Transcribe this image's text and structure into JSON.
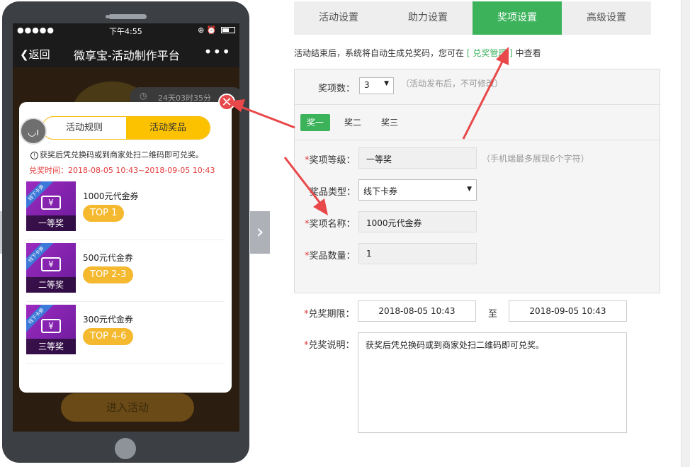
{
  "phone": {
    "status": {
      "signal": "●●●●●",
      "time": "下午4:55"
    },
    "nav": {
      "back": "返回",
      "title": "微享宝-活动制作平台",
      "more": "•••"
    },
    "timer": "24天03时35分",
    "join_button": "进入活动",
    "modal": {
      "close": "✕",
      "tabs": [
        {
          "label": "活动规则"
        },
        {
          "label": "活动奖品"
        }
      ],
      "notice": "获奖后凭兑换码或到商家处扫二维码即可兑奖。",
      "redeem_time": "兑奖时间：2018-08-05 10:43~2018-09-05 10:43",
      "prizes": [
        {
          "ribbon": "线下卡券",
          "grade": "一等奖",
          "name": "1000元代金券",
          "rank": "TOP 1"
        },
        {
          "ribbon": "线下卡券",
          "grade": "二等奖",
          "name": "500元代金券",
          "rank": "TOP 2-3"
        },
        {
          "ribbon": "线下卡券",
          "grade": "三等奖",
          "name": "300元代金券",
          "rank": "TOP 4-6"
        }
      ]
    }
  },
  "top_tabs": [
    {
      "label": "活动设置"
    },
    {
      "label": "助力设置"
    },
    {
      "label": "奖项设置"
    },
    {
      "label": "高级设置"
    }
  ],
  "hint": {
    "before": "活动结束后，系统将自动生成兑奖码，您可在 ",
    "link": "[ 兑奖管理 ]",
    "after": " 中查看"
  },
  "form": {
    "count_label": "奖项数：",
    "count_value": "3",
    "count_note": "（活动发布后，不可修改）",
    "prize_tabs": [
      {
        "label": "奖一"
      },
      {
        "label": "奖二"
      },
      {
        "label": "奖三"
      }
    ],
    "level_label": "奖项等级：",
    "level_value": "一等奖",
    "level_note": "（手机端最多展现6个字符）",
    "type_label": "奖品类型：",
    "type_value": "线下卡券",
    "name_label": "奖项名称：",
    "name_value": "1000元代金券",
    "qty_label": "奖品数量：",
    "qty_value": "1",
    "period_label": "兑奖期限：",
    "period_start": "2018-08-05 10:43",
    "period_to": "至",
    "period_end": "2018-09-05 10:43",
    "desc_label": "兑奖说明：",
    "desc_value": "获奖后凭兑换码或到商家处扫二维码即可兑奖。"
  },
  "colors": {
    "accent_green": "#3cb35b",
    "ticket_purple": "#8a24b4",
    "badge_yellow": "#f5b930",
    "annotation_red": "#e8484a"
  }
}
